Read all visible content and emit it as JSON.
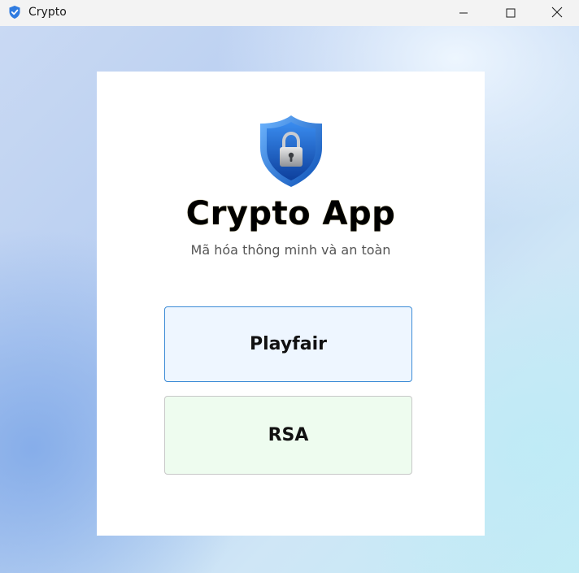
{
  "window": {
    "title": "Crypto",
    "app_icon": "shield-check-icon",
    "controls": {
      "minimize": "minimize-icon",
      "maximize": "maximize-icon",
      "close": "close-icon"
    }
  },
  "main": {
    "logo_icon": "shield-lock-icon",
    "title": "Crypto App",
    "subtitle": "Mã hóa thông minh và an toàn",
    "buttons": [
      {
        "label": "Playfair"
      },
      {
        "label": "RSA"
      }
    ]
  },
  "colors": {
    "accent_blue": "#3c8bd6",
    "playfair_bg": "#eef6ff",
    "rsa_bg": "#eefcef"
  }
}
